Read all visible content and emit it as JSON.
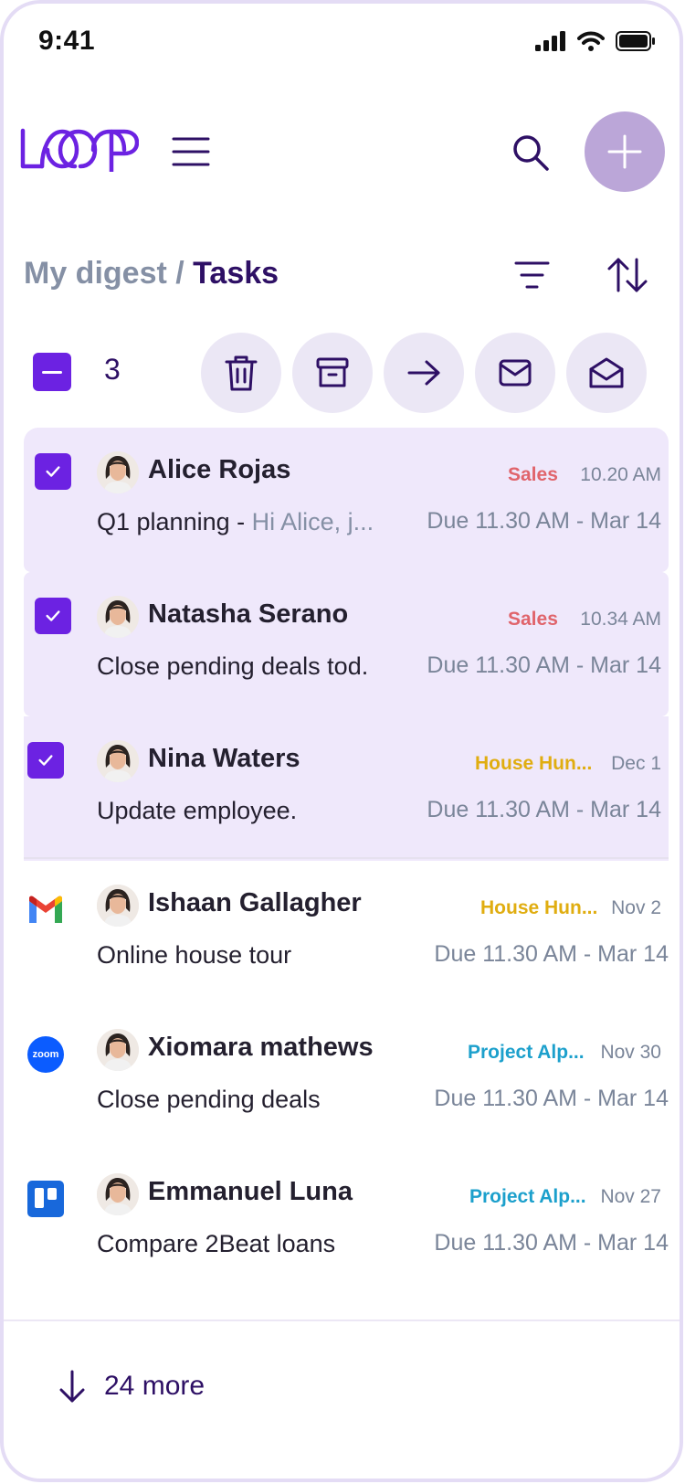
{
  "status_bar": {
    "time": "9:41"
  },
  "header": {
    "logo_text": "LOOP"
  },
  "breadcrumb": {
    "parent": "My digest",
    "separator": "/",
    "current": "Tasks"
  },
  "selection": {
    "count": "3"
  },
  "tasks": [
    {
      "selected": true,
      "source": "",
      "name": "Alice Rojas",
      "tag": "Sales",
      "tag_color": "#e0646b",
      "time": "10.20 AM",
      "subject": "Q1 planning - ",
      "preview": "Hi Alice, j...",
      "due": "Due 11.30 AM - Mar 14"
    },
    {
      "selected": true,
      "source": "",
      "name": "Natasha Serano",
      "tag": "Sales",
      "tag_color": "#e0646b",
      "time": "10.34 AM",
      "subject": "Close pending deals tod.",
      "preview": "",
      "due": "Due 11.30 AM - Mar 14"
    },
    {
      "selected": true,
      "source": "",
      "name": "Nina Waters",
      "tag": "House Hun...",
      "tag_color": "#e0ad10",
      "time": "Dec 1",
      "subject": "Update employee.",
      "preview": "",
      "due": "Due 11.30 AM - Mar 14"
    },
    {
      "selected": false,
      "source": "gmail",
      "name": "Ishaan Gallagher",
      "tag": "House Hun...",
      "tag_color": "#e0ad10",
      "time": "Nov 2",
      "subject": "Online house tour",
      "preview": "",
      "due": "Due 11.30 AM - Mar 14"
    },
    {
      "selected": false,
      "source": "zoom",
      "name": "Xiomara mathews",
      "tag": "Project Alp...",
      "tag_color": "#1ca0cc",
      "time": "Nov 30",
      "subject": "Close pending deals",
      "preview": "",
      "due": "Due 11.30 AM - Mar 14"
    },
    {
      "selected": false,
      "source": "trello",
      "name": "Emmanuel Luna",
      "tag": "Project Alp...",
      "tag_color": "#1ca0cc",
      "time": "Nov 27",
      "subject": "Compare 2Beat loans",
      "preview": "",
      "due": "Due 11.30 AM - Mar 14"
    }
  ],
  "app_icons": {
    "zoom_label": "zoom"
  },
  "footer": {
    "more_label": "24 more"
  },
  "colors": {
    "accent": "#6c22e2",
    "primary_text": "#2e1065",
    "selected_bg": "#efe8fb",
    "fab": "#bba6d8"
  }
}
